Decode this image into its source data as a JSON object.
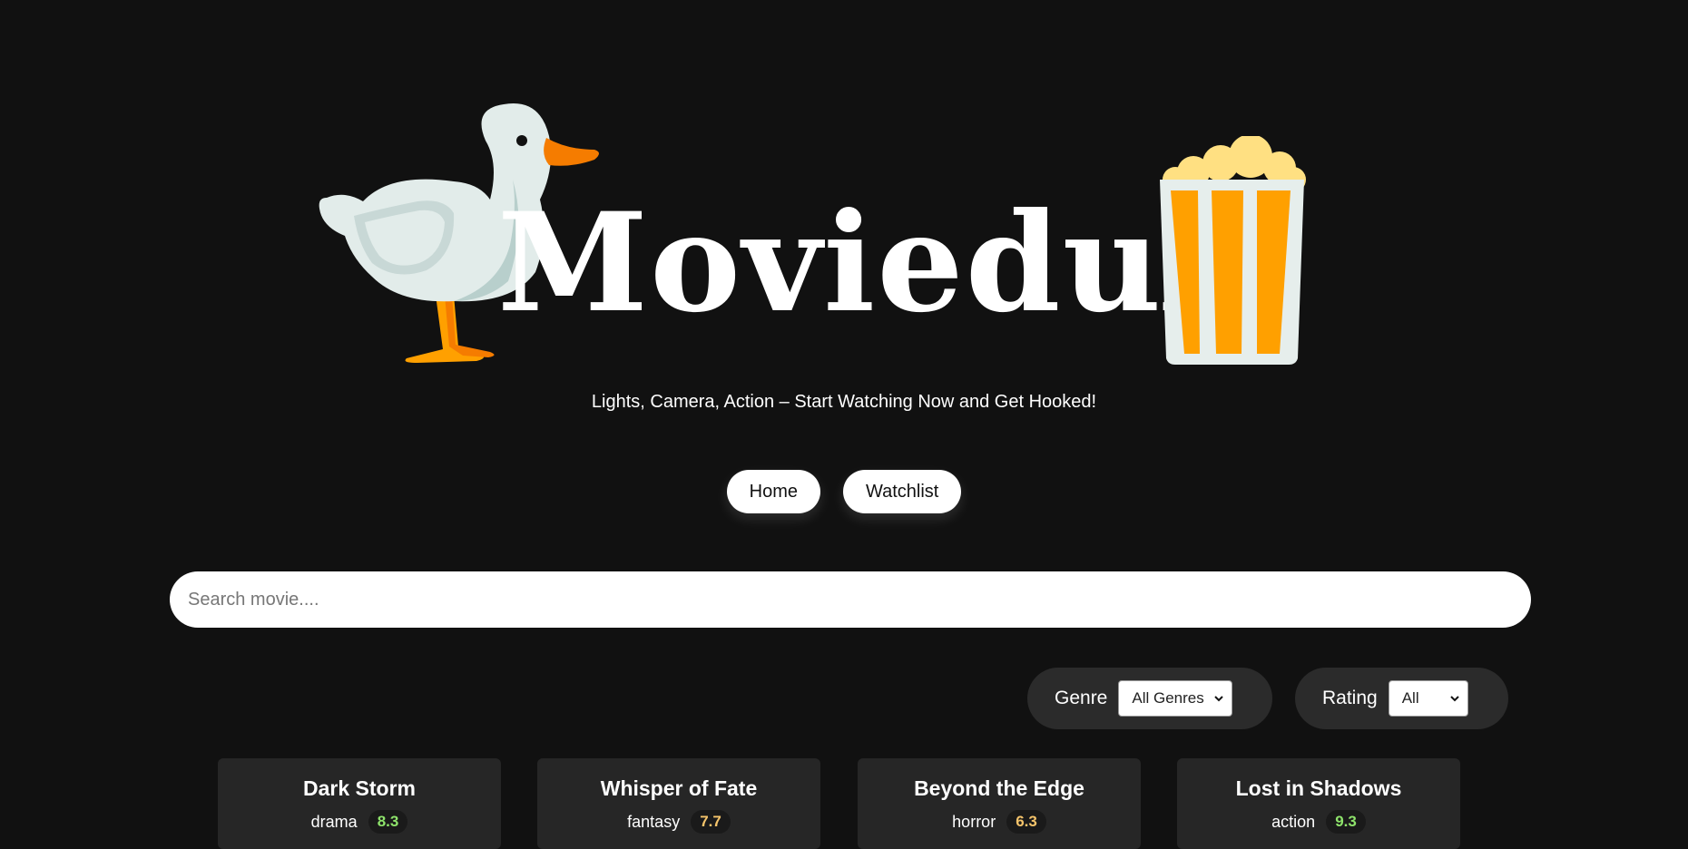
{
  "brand": {
    "name": "Moviedux",
    "tagline": "Lights, Camera, Action – Start Watching Now and Get Hooked!"
  },
  "nav": {
    "home_label": "Home",
    "watchlist_label": "Watchlist"
  },
  "search": {
    "placeholder": "Search movie...."
  },
  "filters": {
    "genre": {
      "label": "Genre",
      "selected": "All Genres"
    },
    "rating": {
      "label": "Rating",
      "selected": "All"
    }
  },
  "colors": {
    "background": "#111111",
    "rating_green": "#8ee36b",
    "rating_amber": "#f5c46b"
  },
  "movies": [
    {
      "title": "Dark Storm",
      "genre": "drama",
      "rating": "8.3",
      "rating_color": "#8ee36b"
    },
    {
      "title": "Whisper of Fate",
      "genre": "fantasy",
      "rating": "7.7",
      "rating_color": "#f5c46b"
    },
    {
      "title": "Beyond the Edge",
      "genre": "horror",
      "rating": "6.3",
      "rating_color": "#f5c46b"
    },
    {
      "title": "Lost in Shadows",
      "genre": "action",
      "rating": "9.3",
      "rating_color": "#8ee36b"
    }
  ]
}
